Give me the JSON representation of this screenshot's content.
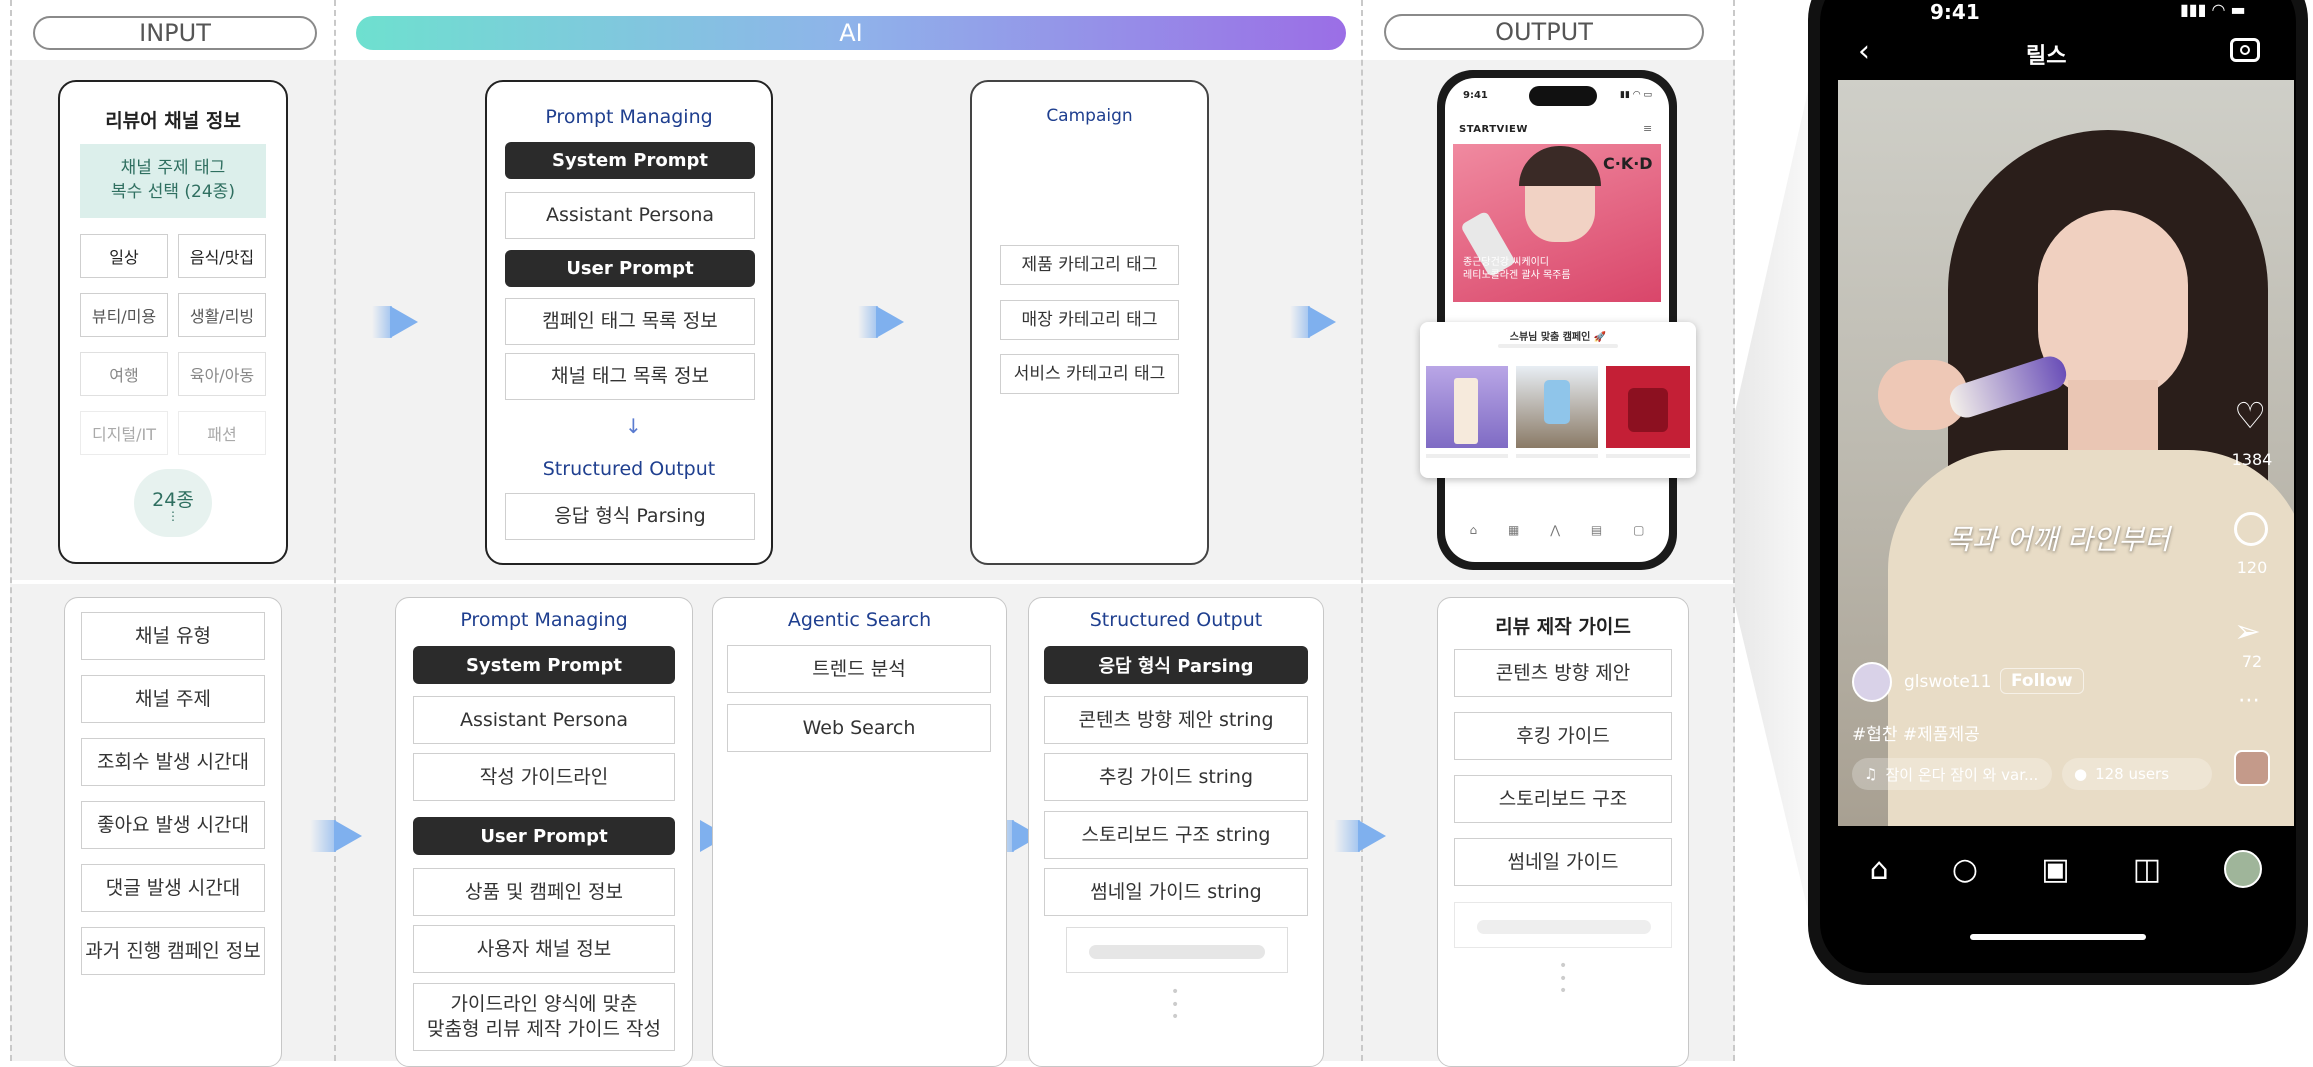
{
  "headers": {
    "input": "INPUT",
    "ai": "AI",
    "output": "OUTPUT"
  },
  "top": {
    "reviewer_channel": {
      "title": "리뷰어 채널 정보",
      "topic_tag": "채널 주제 태그\n복수 선택 (24종)",
      "tags": [
        "일상",
        "음식/맛집",
        "뷰티/미용",
        "생활/리빙",
        "여행",
        "육아/아동",
        "디지털/IT",
        "패션"
      ],
      "count": "24종"
    },
    "prompt_managing": {
      "title": "Prompt Managing",
      "system_prompt": "System Prompt",
      "assistant_persona": "Assistant Persona",
      "user_prompt": "User Prompt",
      "campaign_tags": "캠페인 태그 목록 정보",
      "channel_tags": "채널 태그 목록 정보",
      "structured_output": "Structured Output",
      "parsing": "응답 형식 Parsing"
    },
    "campaign": {
      "title": "Campaign",
      "items": [
        "제품 카테고리 태그",
        "매장 카테고리 태그",
        "서비스 카테고리 태그"
      ]
    },
    "phone": {
      "time": "9:41",
      "app_name": "STARTVIEW",
      "brand": "C·K·D",
      "banner_text": "종근당건강 씨케이디\n레티노콜라겐 괄사 목주름",
      "popup_title": "스뷰님 맞춤 캠페인 🚀"
    }
  },
  "bottom": {
    "channel_info": [
      "채널 유형",
      "채널 주제",
      "조회수 발생 시간대",
      "좋아요 발생 시간대",
      "댓글 발생 시간대",
      "과거 진행 캠페인 정보"
    ],
    "prompt_managing": {
      "title": "Prompt Managing",
      "system_prompt": "System Prompt",
      "assistant_persona": "Assistant Persona",
      "guideline": "작성 가이드라인",
      "user_prompt": "User Prompt",
      "product_info": "상품 및 캠페인 정보",
      "user_channel": "사용자 채널 정보",
      "custom_guide": "가이드라인 양식에 맞춘\n맞춤형 리뷰 제작 가이드 작성"
    },
    "agentic_search": {
      "title": "Agentic Search",
      "items": [
        "트렌드 분석",
        "Web Search"
      ]
    },
    "structured_output": {
      "title": "Structured Output",
      "parsing": "응답 형식 Parsing",
      "items": [
        "콘텐츠 방향 제안  string",
        "추킹 가이드  string",
        "스토리보드 구조  string",
        "썸네일 가이드  string"
      ]
    },
    "review_guide": {
      "title": "리뷰 제작 가이드",
      "items": [
        "콘텐츠 방향 제안",
        "후킹 가이드",
        "스토리보드 구조",
        "썸네일 가이드"
      ]
    }
  },
  "reels": {
    "time": "9:41",
    "title": "릴스",
    "caption": "목과 어깨 라인부터",
    "likes": "1384",
    "comments": "120",
    "shares": "72",
    "username": "glswote11",
    "follow": "Follow",
    "hashtags": "#협찬 #제품제공",
    "music": "잠이 온다 잠이 와 var...",
    "users": "128 users"
  },
  "colors": {
    "accent_blue": "#1f3f8f",
    "arrow": "#7fb0ee",
    "mint": "#dcefeb",
    "dark_button": "#2b2b2b"
  }
}
